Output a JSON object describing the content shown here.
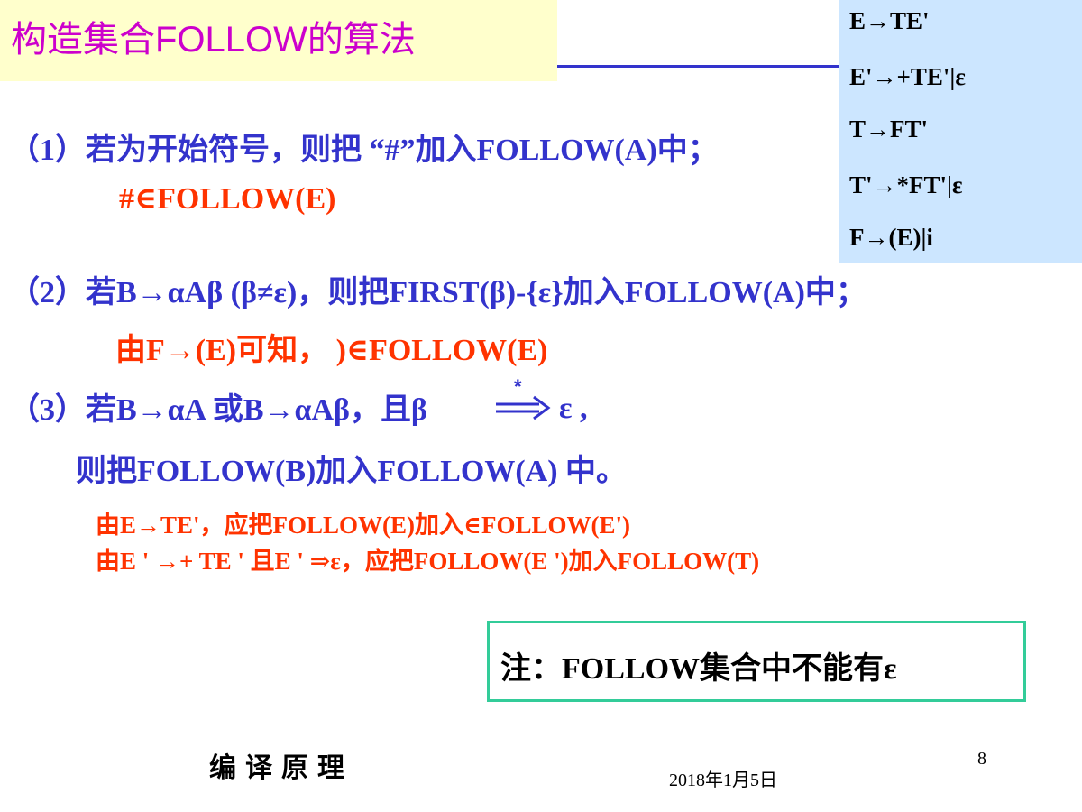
{
  "title": "构造集合FOLLOW的算法",
  "grammar": [
    "E→TE'",
    "E'→+TE'|ε",
    "T→FT'",
    "T'→*FT'|ε",
    "F→(E)|i"
  ],
  "rules": {
    "rule1": "（1）若为开始符号，则把 “#”加入FOLLOW(A)中；",
    "rule1_example": "#∈FOLLOW(E)",
    "rule2": "（2）若B→αAβ (β≠ε)，则把FIRST(β)-{ε}加入FOLLOW(A)中；",
    "rule2_example": "由F→(E)可知， )∈FOLLOW(E)",
    "rule3": "（3）若B→αA 或B→αAβ，且β",
    "rule3_derive_star": "*",
    "rule3_end": "ε ,",
    "rule3_cont": "则把FOLLOW(B)加入FOLLOW(A) 中。",
    "rule3_example1": "由E→TE'，应把FOLLOW(E)加入∈FOLLOW(E')",
    "rule3_example2": "由E ' →+ TE ' 且E ' ⇒ε，应把FOLLOW(E ')加入FOLLOW(T)"
  },
  "note": "注：FOLLOW集合中不能有ε",
  "footer": {
    "course": "编译原理",
    "date": "2018年1月5日",
    "page": "8"
  },
  "colors": {
    "title": "#cc00cc",
    "title_bg": "#ffffcc",
    "grammar_bg": "#cce6ff",
    "rule_text": "#3333cc",
    "example_text": "#ff3300",
    "note_border": "#33cc99"
  }
}
